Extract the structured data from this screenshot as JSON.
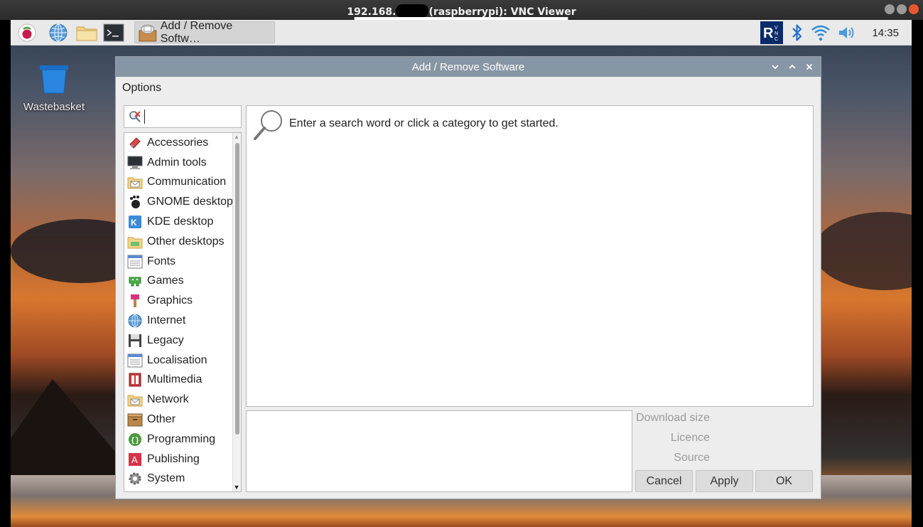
{
  "vnc": {
    "title_prefix": "192.168.",
    "title_suffix": "(raspberrypi): VNC Viewer"
  },
  "taskbar": {
    "launchers": [
      "raspberry-menu-icon",
      "web-browser-icon",
      "file-manager-icon",
      "terminal-icon"
    ],
    "task_label": "Add / Remove Softw…",
    "clock": "14:35",
    "tray_icons": [
      "vnc-server-icon",
      "bluetooth-icon",
      "wifi-icon",
      "volume-icon"
    ]
  },
  "desktop": {
    "wastebasket_label": "Wastebasket"
  },
  "dialog": {
    "title": "Add / Remove Software",
    "menu_options": "Options",
    "search": {
      "value": "",
      "placeholder": ""
    },
    "categories": [
      {
        "label": "Accessories",
        "icon": "accessories-icon"
      },
      {
        "label": "Admin tools",
        "icon": "admin-tools-icon"
      },
      {
        "label": "Communication",
        "icon": "communication-icon"
      },
      {
        "label": "GNOME desktop",
        "icon": "gnome-icon"
      },
      {
        "label": "KDE desktop",
        "icon": "kde-icon"
      },
      {
        "label": "Other desktops",
        "icon": "other-desktops-icon"
      },
      {
        "label": "Fonts",
        "icon": "fonts-icon"
      },
      {
        "label": "Games",
        "icon": "games-icon"
      },
      {
        "label": "Graphics",
        "icon": "graphics-icon"
      },
      {
        "label": "Internet",
        "icon": "internet-icon"
      },
      {
        "label": "Legacy",
        "icon": "legacy-icon"
      },
      {
        "label": "Localisation",
        "icon": "localisation-icon"
      },
      {
        "label": "Multimedia",
        "icon": "multimedia-icon"
      },
      {
        "label": "Network",
        "icon": "network-icon"
      },
      {
        "label": "Other",
        "icon": "other-icon"
      },
      {
        "label": "Programming",
        "icon": "programming-icon"
      },
      {
        "label": "Publishing",
        "icon": "publishing-icon"
      },
      {
        "label": "System",
        "icon": "system-icon"
      }
    ],
    "results_message": "Enter a search word or click a category to get started.",
    "info": {
      "download_size": "Download size",
      "licence": "Licence",
      "source": "Source"
    },
    "buttons": {
      "cancel": "Cancel",
      "apply": "Apply",
      "ok": "OK"
    }
  }
}
